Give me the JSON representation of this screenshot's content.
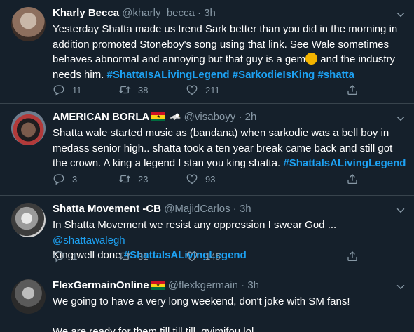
{
  "tweets": [
    {
      "name": "Kharly Becca",
      "handle": "@kharly_becca",
      "time": "3h",
      "body": {
        "text1": "Yesterday Shatta made us trend Sark better than you did in the morning in addition promoted Stoneboy's song using that link. See Wale sometimes behaves abnormal and annoying but that guy is a gem",
        "text2": " and the industry needs him. ",
        "tag1": "#ShattaIsALivingLegend",
        "tag2": "#SarkodieIsKing",
        "tag3": "#shatta"
      },
      "replies": "11",
      "retweets": "38",
      "likes": "211"
    },
    {
      "name": "AMERICAN BORLA",
      "handle": "@visaboyy",
      "time": "2h",
      "body": {
        "text1": "Shatta wale started music as (bandana) when sarkodie was a bell boy in medass senior high.. shatta took a ten year break came back and still got the crown. A king a legend I stan you king shatta. ",
        "tag1": "#ShattaIsALivingLegend"
      },
      "replies": "3",
      "retweets": "23",
      "likes": "93"
    },
    {
      "name": "Shatta Movement -CB",
      "handle": "@MajidCarlos",
      "time": "3h",
      "body": {
        "text1": "In Shatta Movement we resist any oppression I swear God ... ",
        "mention": "@shattawalegh",
        "text2": " King well done ",
        "tag1": "#ShattaIsALivingLegend"
      },
      "replies": "1",
      "retweets": "31",
      "likes": "145"
    },
    {
      "name": "FlexGermainOnline",
      "handle": "@flexkgermain",
      "time": "3h",
      "body": {
        "line1": "We going to have a very long weekend, don't joke with SM fans!",
        "line2": "We are ready for them till till till..gyimifou lol"
      }
    }
  ],
  "separator": "·",
  "icons": [
    "reply-icon",
    "retweet-icon",
    "like-icon",
    "share-icon",
    "chevron-down-icon"
  ],
  "colors": {
    "background": "#15202b",
    "link": "#1da1f2",
    "muted": "#8899a6",
    "divider": "#38444d"
  }
}
